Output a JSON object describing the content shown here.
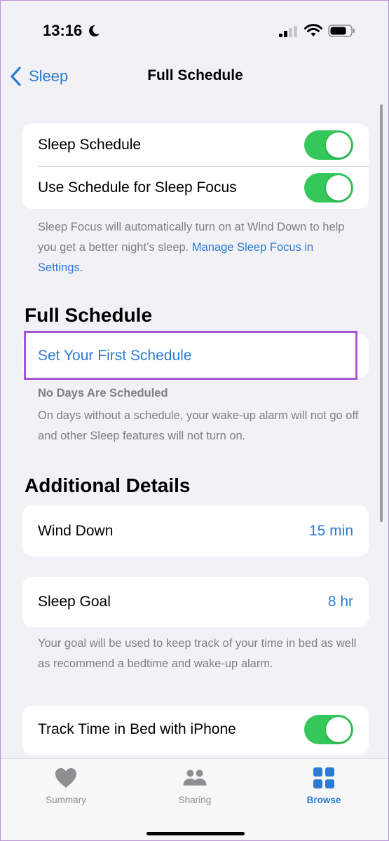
{
  "status_bar": {
    "time": "13:16"
  },
  "nav": {
    "back_label": "Sleep",
    "title": "Full Schedule"
  },
  "focus_card": {
    "sleep_schedule_label": "Sleep Schedule",
    "sleep_schedule_on": true,
    "use_schedule_label": "Use Schedule for Sleep Focus",
    "use_schedule_on": true,
    "footnote_text": "Sleep Focus will automatically turn on at Wind Down to help you get a better night’s sleep.",
    "footnote_link": "Manage Sleep Focus in Settings."
  },
  "full_schedule": {
    "header": "Full Schedule",
    "set_first_label": "Set Your First Schedule",
    "no_days_title": "No Days Are Scheduled",
    "no_days_text": "On days without a schedule, your wake-up alarm will not go off and other Sleep features will not turn on."
  },
  "additional": {
    "header": "Additional Details",
    "wind_down_label": "Wind Down",
    "wind_down_value": "15 min",
    "sleep_goal_label": "Sleep Goal",
    "sleep_goal_value": "8 hr",
    "goal_footnote": "Your goal will be used to keep track of your time in bed as well as recommend a bedtime and wake-up alarm.",
    "track_label": "Track Time in Bed with iPhone",
    "track_on": true
  },
  "tab_bar": {
    "tabs": [
      {
        "label": "Summary",
        "icon": "heart-icon",
        "active": false
      },
      {
        "label": "Sharing",
        "icon": "people-icon",
        "active": false
      },
      {
        "label": "Browse",
        "icon": "grid-icon",
        "active": true
      }
    ]
  },
  "colors": {
    "accent": "#2a7bd4",
    "toggle_on": "#34c759",
    "highlight": "#a855d8"
  }
}
